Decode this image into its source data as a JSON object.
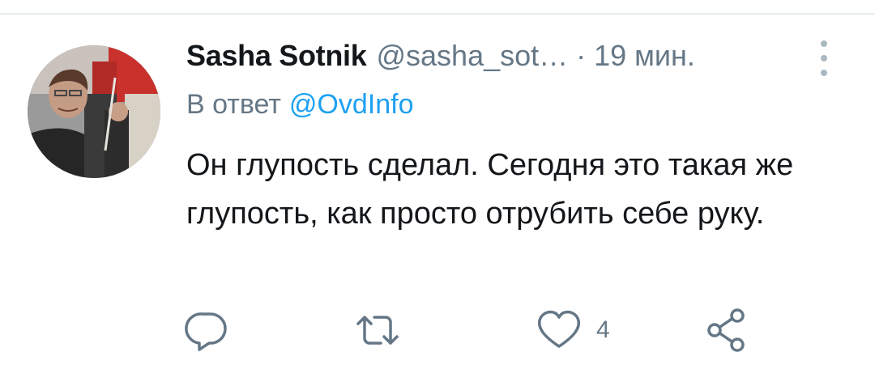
{
  "tweet": {
    "author_name": "Sasha Sotnik",
    "author_handle": "@sasha_sot…",
    "separator": "·",
    "timestamp": "19 мин.",
    "reply_prefix": "В ответ",
    "reply_to": "@OvdInfo",
    "text": "Он глупость сделал. Сегодня это такая же глупость, как просто отрубить себе руку."
  },
  "actions": {
    "reply_icon": "reply-icon",
    "retweet_icon": "retweet-icon",
    "like_icon": "heart-icon",
    "like_count": "4",
    "share_icon": "share-icon"
  },
  "colors": {
    "text_primary": "#14171a",
    "text_secondary": "#657786",
    "link": "#1da1f2",
    "icon": "#657786"
  }
}
